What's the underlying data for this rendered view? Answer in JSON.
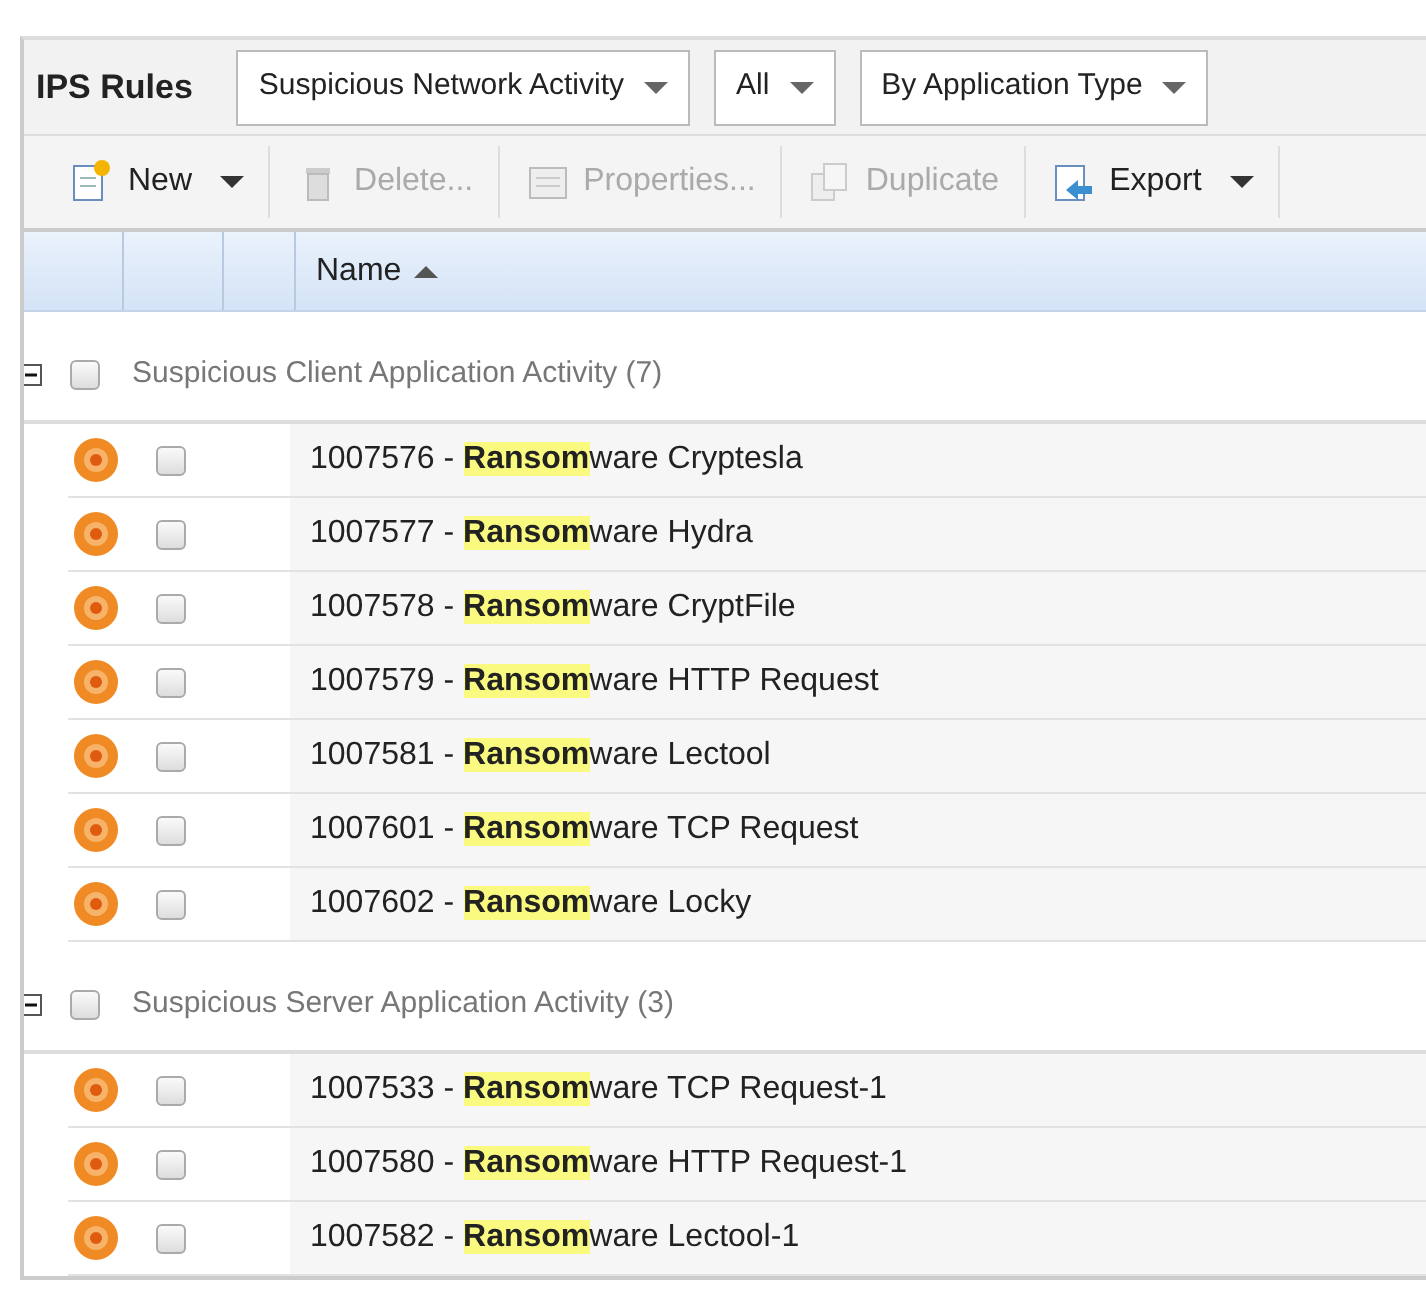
{
  "title": "IPS Rules",
  "filters": [
    {
      "label": "Suspicious Network Activity"
    },
    {
      "label": "All"
    },
    {
      "label": "By Application Type"
    }
  ],
  "toolbar": [
    {
      "kind": "new",
      "label": "New",
      "disabled": false,
      "menu": true
    },
    {
      "kind": "delete",
      "label": "Delete...",
      "disabled": true,
      "menu": false
    },
    {
      "kind": "properties",
      "label": "Properties...",
      "disabled": true,
      "menu": false
    },
    {
      "kind": "duplicate",
      "label": "Duplicate",
      "disabled": true,
      "menu": false
    },
    {
      "kind": "export",
      "label": "Export",
      "disabled": false,
      "menu": true
    }
  ],
  "table": {
    "columns": [
      {
        "label": "Name",
        "sorted": true
      }
    ],
    "groups": [
      {
        "label": "Suspicious Client Application Activity (7)",
        "expanded": true,
        "checked": false,
        "rows": [
          {
            "name": "1007576 - **Ransom**ware Cryptesla",
            "checked": false
          },
          {
            "name": "1007577 - **Ransom**ware Hydra",
            "checked": false
          },
          {
            "name": "1007578 - **Ransom**ware CryptFile",
            "checked": false
          },
          {
            "name": "1007579 - **Ransom**ware HTTP Request",
            "checked": false
          },
          {
            "name": "1007581 - **Ransom**ware Lectool",
            "checked": false
          },
          {
            "name": "1007601 - **Ransom**ware TCP Request",
            "checked": false
          },
          {
            "name": "1007602 - **Ransom**ware Locky",
            "checked": false
          }
        ]
      },
      {
        "label": "Suspicious Server Application Activity (3)",
        "expanded": true,
        "checked": false,
        "rows": [
          {
            "name": "1007533 - **Ransom**ware TCP Request-1",
            "checked": false
          },
          {
            "name": "1007580 - **Ransom**ware HTTP Request-1",
            "checked": false
          },
          {
            "name": "1007582 - **Ransom**ware Lectool-1",
            "checked": false
          }
        ]
      }
    ]
  }
}
